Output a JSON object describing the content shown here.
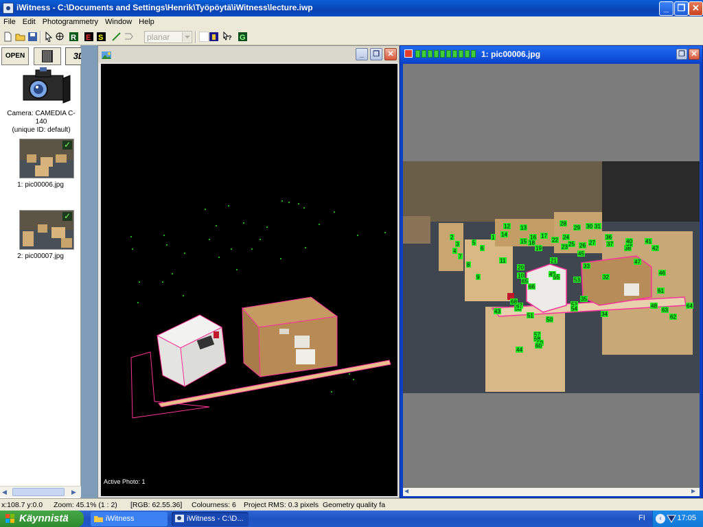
{
  "window": {
    "title": "iWitness - C:\\Documents and Settings\\Henrik\\Työpöytä\\iWitness\\lecture.iwp",
    "minimize": "_",
    "maximize": "❐",
    "close": "✕"
  },
  "menu": [
    "File",
    "Edit",
    "Photogrammetry",
    "Window",
    "Help"
  ],
  "toolbar": {
    "surface_combo": "planar"
  },
  "left_panel": {
    "tab_open": "OPEN",
    "tab_3d": "3D",
    "camera_label": "Camera: CAMEDIA C-140",
    "camera_id": "(unique ID: default)",
    "photos": [
      {
        "label": "1: pic00006.jpg",
        "checked": "✓"
      },
      {
        "label": "2: pic00007.jpg",
        "checked": "✓"
      }
    ]
  },
  "view3d": {
    "active_photo": "Active Photo: 1"
  },
  "photo_window": {
    "title": "1: pic00006.jpg",
    "points": [
      "1",
      "2",
      "3",
      "4",
      "5",
      "6",
      "7",
      "8",
      "9",
      "10",
      "11",
      "12",
      "13",
      "14",
      "15",
      "16",
      "17",
      "18",
      "19",
      "20",
      "21",
      "22",
      "23",
      "24",
      "25",
      "26",
      "27",
      "28",
      "29",
      "30",
      "31",
      "32",
      "33",
      "34",
      "35",
      "36",
      "37",
      "38",
      "39",
      "40",
      "41",
      "42",
      "43",
      "44",
      "45",
      "46",
      "47",
      "48",
      "49",
      "50",
      "51",
      "52",
      "53",
      "54",
      "55",
      "56",
      "57",
      "58",
      "59",
      "60",
      "61",
      "62",
      "63",
      "64",
      "65",
      "66",
      "67",
      "68"
    ]
  },
  "status": {
    "coords": "x:108.7 y:0.0",
    "zoom": "Zoom: 45.1% (1 : 2)",
    "rgb": "[RGB: 62.55.36]",
    "colourness": "Colourness: 6",
    "rms": "Project RMS: 0.3 pixels",
    "quality": "Geometry quality fa"
  },
  "taskbar": {
    "start": "Käynnistä",
    "tasks": [
      "iWitness",
      "iWitness - C:\\D..."
    ],
    "lang": "FI",
    "clock": "17:05"
  },
  "colors": {
    "point": "#22ee22",
    "outline": "#ff3399"
  }
}
